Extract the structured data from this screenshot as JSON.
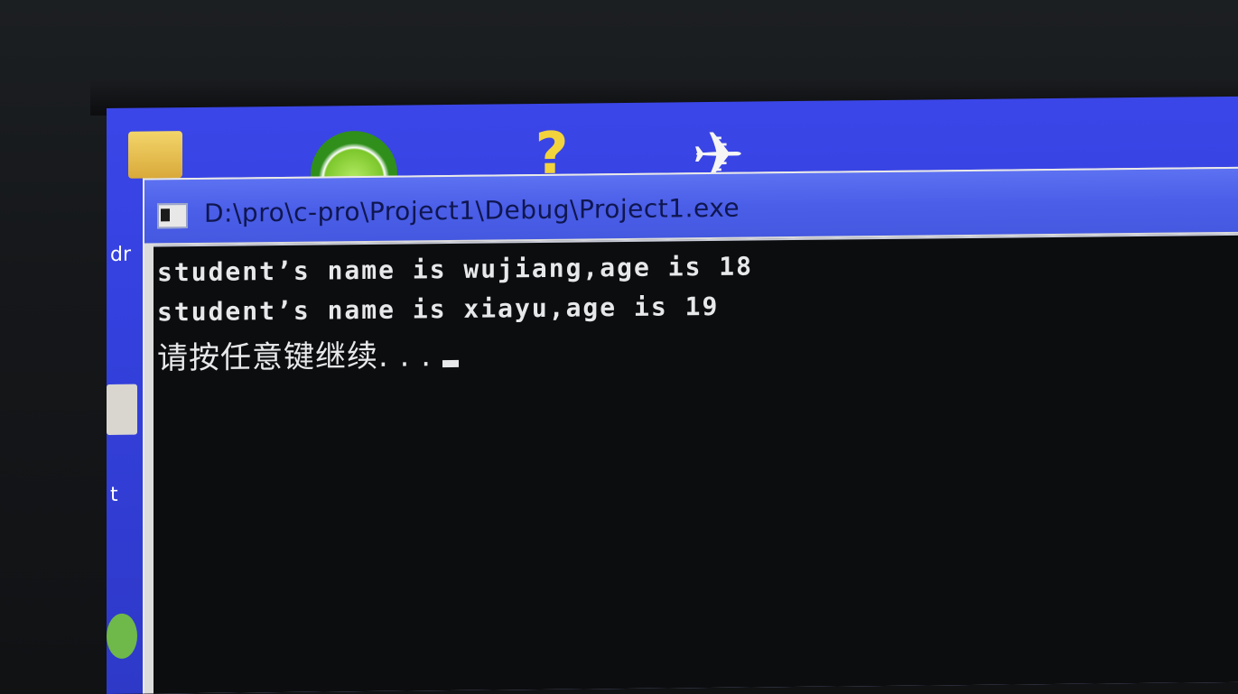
{
  "window": {
    "title": "D:\\pro\\c-pro\\Project1\\Debug\\Project1.exe"
  },
  "console": {
    "lines": [
      "student’s name is wujiang,age is 18",
      "student’s name is xiayu,age is 19",
      "请按任意键继续. . ."
    ]
  },
  "desktop": {
    "icons": [
      "folder-icon",
      "green-app-icon",
      "help-icon",
      "paper-plane-icon"
    ],
    "side_labels": [
      "dr",
      "t"
    ]
  },
  "colors": {
    "desktop_background": "#3340dc",
    "titlebar": "#4a5ee8",
    "console_background": "#0c0d0f",
    "console_text": "#e7e8ea"
  }
}
